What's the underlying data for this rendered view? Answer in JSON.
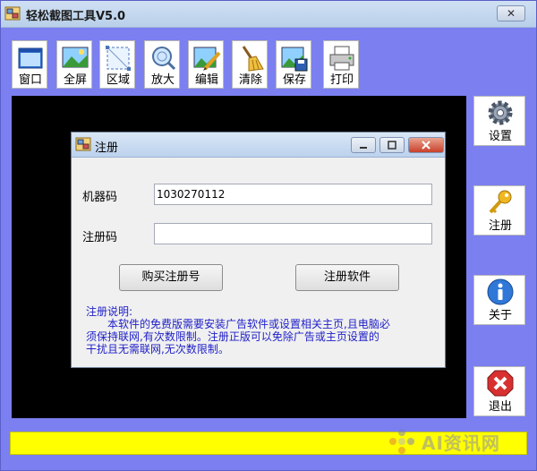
{
  "app": {
    "title": "轻松截图工具V5.0",
    "close_label": "✕"
  },
  "toolbar": {
    "items": [
      {
        "label": "窗口",
        "icon": "window-icon"
      },
      {
        "label": "全屏",
        "icon": "fullscreen-icon"
      },
      {
        "label": "区域",
        "icon": "region-icon"
      },
      {
        "label": "放大",
        "icon": "magnifier-icon"
      },
      {
        "label": "编辑",
        "icon": "edit-icon"
      },
      {
        "label": "清除",
        "icon": "broom-icon"
      },
      {
        "label": "保存",
        "icon": "save-icon"
      },
      {
        "label": "打印",
        "icon": "printer-icon"
      }
    ]
  },
  "side": {
    "items": [
      {
        "label": "设置",
        "icon": "gear-icon"
      },
      {
        "label": "注册",
        "icon": "key-icon"
      },
      {
        "label": "关于",
        "icon": "info-icon"
      },
      {
        "label": "退出",
        "icon": "exit-icon"
      }
    ]
  },
  "dialog": {
    "title": "注册",
    "machine_code_label": "机器码",
    "machine_code_value": "1030270112",
    "reg_code_label": "注册码",
    "reg_code_value": "",
    "buy_button": "购买注册号",
    "register_button": "注册软件",
    "info_lines": [
      "注册说明:",
      "　　本软件的免费版需要安装广告软件或设置相关主页,且电脑必",
      "须保持联网,有次数限制。注册正版可以免除广告或主页设置的",
      "干扰且无需联网,无次数限制。"
    ]
  },
  "watermark": {
    "text": "AI资讯网"
  },
  "colors": {
    "window_bg": "#7b7ff0",
    "canvas": "#000000",
    "status_bar": "#ffff00",
    "info_text": "#1e1ec8"
  }
}
